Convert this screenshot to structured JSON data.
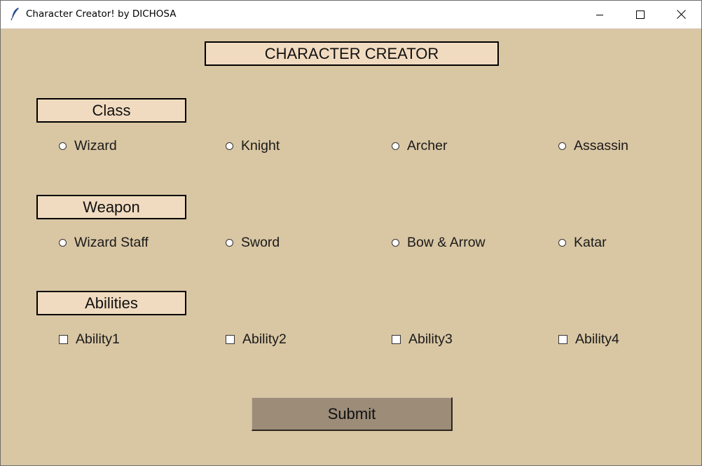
{
  "window": {
    "title": "Character Creator! by DICHOSA",
    "icon": "feather-icon",
    "controls": [
      "minimize-icon",
      "maximize-icon",
      "close-icon"
    ]
  },
  "main_title": "CHARACTER CREATOR",
  "sections": {
    "class": {
      "label": "Class",
      "control": "radio",
      "options": [
        "Wizard",
        "Knight",
        "Archer",
        "Assassin"
      ]
    },
    "weapon": {
      "label": "Weapon",
      "control": "radio",
      "options": [
        "Wizard Staff",
        "Sword",
        "Bow & Arrow",
        "Katar"
      ]
    },
    "abilities": {
      "label": "Abilities",
      "control": "checkbox",
      "options": [
        "Ability1",
        "Ability2",
        "Ability3",
        "Ability4"
      ]
    }
  },
  "submit_label": "Submit",
  "colors": {
    "background": "#d9c6a3",
    "label_box": "#f1dbc0",
    "submit_button": "#9c8c78"
  }
}
